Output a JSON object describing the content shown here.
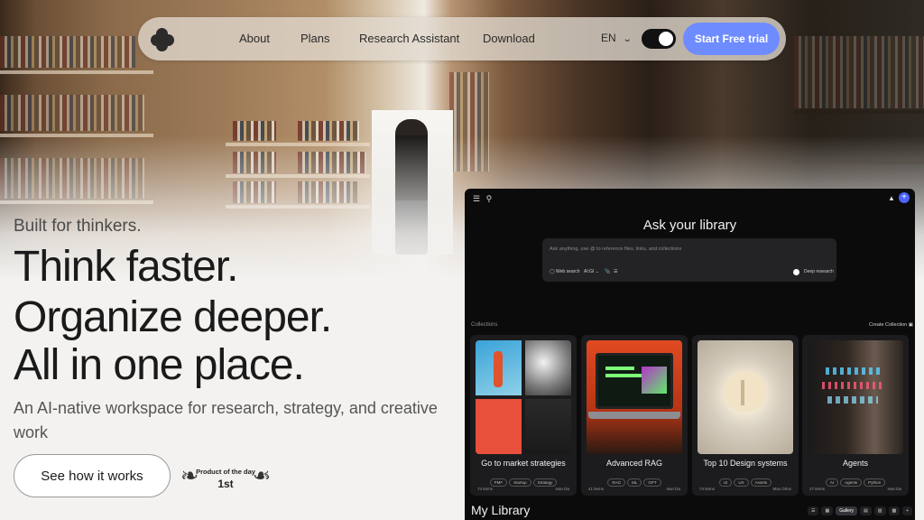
{
  "nav": {
    "links": [
      "About",
      "Plans",
      "Research Assistant",
      "Download"
    ],
    "language": "EN",
    "cta_label": "Start Free trial"
  },
  "hero": {
    "tagline": "Built for thinkers.",
    "headline_lines": [
      "Think faster.",
      "Organize deeper.",
      "All in one place."
    ],
    "subtitle": "An AI-native workspace for research, strategy, and creative work",
    "cta_secondary": "See how it works",
    "badge": {
      "line1": "Product of the day",
      "line2": "1st"
    }
  },
  "app": {
    "ask_title": "Ask your library",
    "ask_placeholder": "Ask anything, use @ to reference files, links, and collections",
    "controls": {
      "web_search": "Web search",
      "model": "AI:GI",
      "deep_research": "Deep research"
    },
    "collections_label": "Collections",
    "create_collection": "Create Collection",
    "cards": [
      {
        "name": "Go to market strategies",
        "tags": [
          "PMF",
          "Startup",
          "Strategy"
        ],
        "meta": "74 items",
        "owner": "Ivan Da"
      },
      {
        "name": "Advanced RAG",
        "tags": [
          "RAG",
          "ML",
          "GPT"
        ],
        "meta": "41 items",
        "owner": "Ivan Da"
      },
      {
        "name": "Top 10 Design systems",
        "tags": [
          "UI",
          "UX",
          "Assets"
        ],
        "meta": "74 items",
        "owner": "Max Orlov"
      },
      {
        "name": "Agents",
        "tags": [
          "AI",
          "Agents",
          "Python"
        ],
        "meta": "27 items",
        "owner": "Ivan Da"
      }
    ],
    "my_library": "My Library",
    "view_options": [
      "Gallery"
    ]
  },
  "colors": {
    "accent": "#6e8cff",
    "app_bg": "#0b0b0c",
    "page_bg": "#f3f2f0"
  }
}
